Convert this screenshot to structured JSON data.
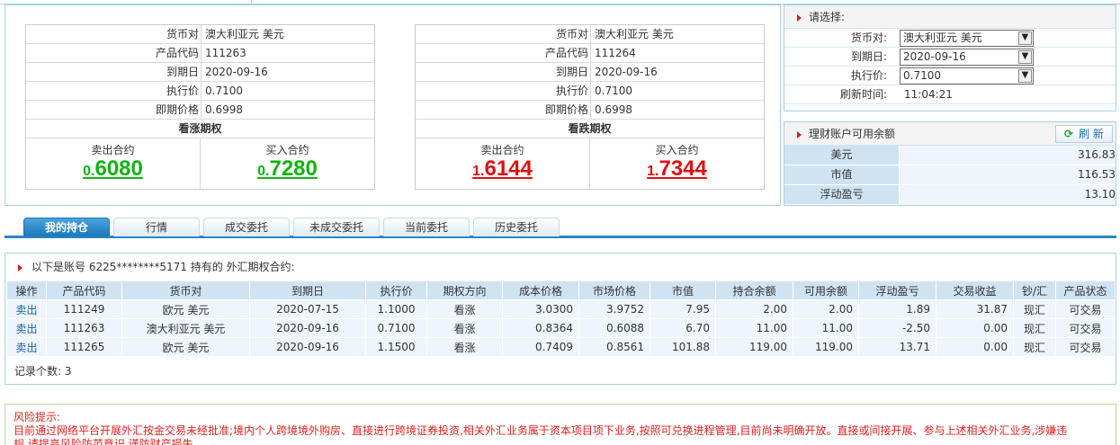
{
  "call_card": {
    "pair_label": "货币对",
    "pair": "澳大利亚元 美元",
    "code_label": "产品代码",
    "code": "111263",
    "expiry_label": "到期日",
    "expiry": "2020-09-16",
    "strike_label": "执行价",
    "strike": "0.7100",
    "spot_label": "即期价格",
    "spot": "0.6998",
    "title": "看涨期权",
    "sell_label": "卖出合约",
    "sell_prefix": "0.",
    "sell_main": "6080",
    "buy_label": "买入合约",
    "buy_prefix": "0.",
    "buy_main": "7280"
  },
  "put_card": {
    "pair_label": "货币对",
    "pair": "澳大利亚元 美元",
    "code_label": "产品代码",
    "code": "111264",
    "expiry_label": "到期日",
    "expiry": "2020-09-16",
    "strike_label": "执行价",
    "strike": "0.7100",
    "spot_label": "即期价格",
    "spot": "0.6998",
    "title": "看跌期权",
    "sell_label": "卖出合约",
    "sell_prefix": "1.",
    "sell_main": "6144",
    "buy_label": "买入合约",
    "buy_prefix": "1.",
    "buy_main": "7344"
  },
  "selector": {
    "title": "请选择:",
    "pair_label": "货币对:",
    "pair_value": "澳大利亚元 美元",
    "expiry_label": "到期日:",
    "expiry_value": "2020-09-16",
    "strike_label": "执行价:",
    "strike_value": "0.7100",
    "refresh_label": "刷新时间:",
    "refresh_time": "11:04:21"
  },
  "balance": {
    "title": "理财账户可用余额",
    "refresh_button": "刷 新",
    "rows": [
      {
        "k": "美元",
        "v": "316.83"
      },
      {
        "k": "市值",
        "v": "116.53"
      },
      {
        "k": "浮动盈亏",
        "v": "13.10"
      }
    ]
  },
  "tabs": [
    "我的持仓",
    "行情",
    "成交委托",
    "未成交委托",
    "当前委托",
    "历史委托"
  ],
  "holdings": {
    "heading": "以下是账号 6225********5171 持有的 外汇期权合约:",
    "columns": [
      "操作",
      "产品代码",
      "货币对",
      "到期日",
      "执行价",
      "期权方向",
      "成本价格",
      "市场价格",
      "市值",
      "持合余额",
      "可用余额",
      "浮动盈亏",
      "交易收益",
      "钞/汇",
      "产品状态"
    ],
    "rows": [
      [
        "卖出",
        "111249",
        "欧元 美元",
        "2020-07-15",
        "1.1000",
        "看涨",
        "3.0300",
        "3.9752",
        "7.95",
        "2.00",
        "2.00",
        "1.89",
        "31.87",
        "现汇",
        "可交易"
      ],
      [
        "卖出",
        "111263",
        "澳大利亚元 美元",
        "2020-09-16",
        "0.7100",
        "看涨",
        "0.8364",
        "0.6088",
        "6.70",
        "11.00",
        "11.00",
        "-2.50",
        "0.00",
        "现汇",
        "可交易"
      ],
      [
        "卖出",
        "111265",
        "欧元 美元",
        "2020-09-16",
        "1.1500",
        "看涨",
        "0.7409",
        "0.8561",
        "101.88",
        "119.00",
        "119.00",
        "13.71",
        "0.00",
        "现汇",
        "可交易"
      ]
    ],
    "record_count_label": "记录个数:",
    "record_count": "3"
  },
  "risk": {
    "title": "风险提示:",
    "line1": "目前通过网络平台开展外汇按金交易未经批准;境内个人跨境境外购房、直接进行跨境证券投资,相关外汇业务属于资本项目项下业务,按照可兑换进程管理,目前尚未明确开放。直接或间接开展、参与上述相关外汇业务,涉嫌违",
    "line2": "规,请提高风险防范意识,谨防财产损失。"
  },
  "colors": {
    "call_price": "#12b312",
    "put_price": "#e01010",
    "tab_active": "#1a78b8"
  }
}
